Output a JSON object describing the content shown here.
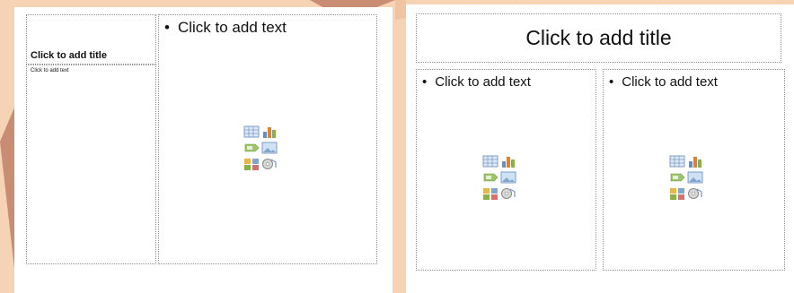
{
  "slides": [
    {
      "layout": "content-with-caption",
      "title_placeholder": "Click to add title",
      "caption_placeholder": "Click to add text",
      "content_placeholder": "Click to add text",
      "content_icons": [
        "insert-table-icon",
        "insert-chart-icon",
        "insert-smartart-icon",
        "insert-picture-icon",
        "insert-clipart-icon",
        "insert-media-icon"
      ]
    },
    {
      "layout": "two-content",
      "title_placeholder": "Click to add title",
      "content_left_placeholder": "Click to add text",
      "content_right_placeholder": "Click to add text",
      "content_icons": [
        "insert-table-icon",
        "insert-chart-icon",
        "insert-smartart-icon",
        "insert-picture-icon",
        "insert-clipart-icon",
        "insert-media-icon"
      ]
    }
  ],
  "colors": {
    "background": "#f6d3b4",
    "decoration": "#c98d73",
    "placeholder_border": "#8f8f8f"
  }
}
